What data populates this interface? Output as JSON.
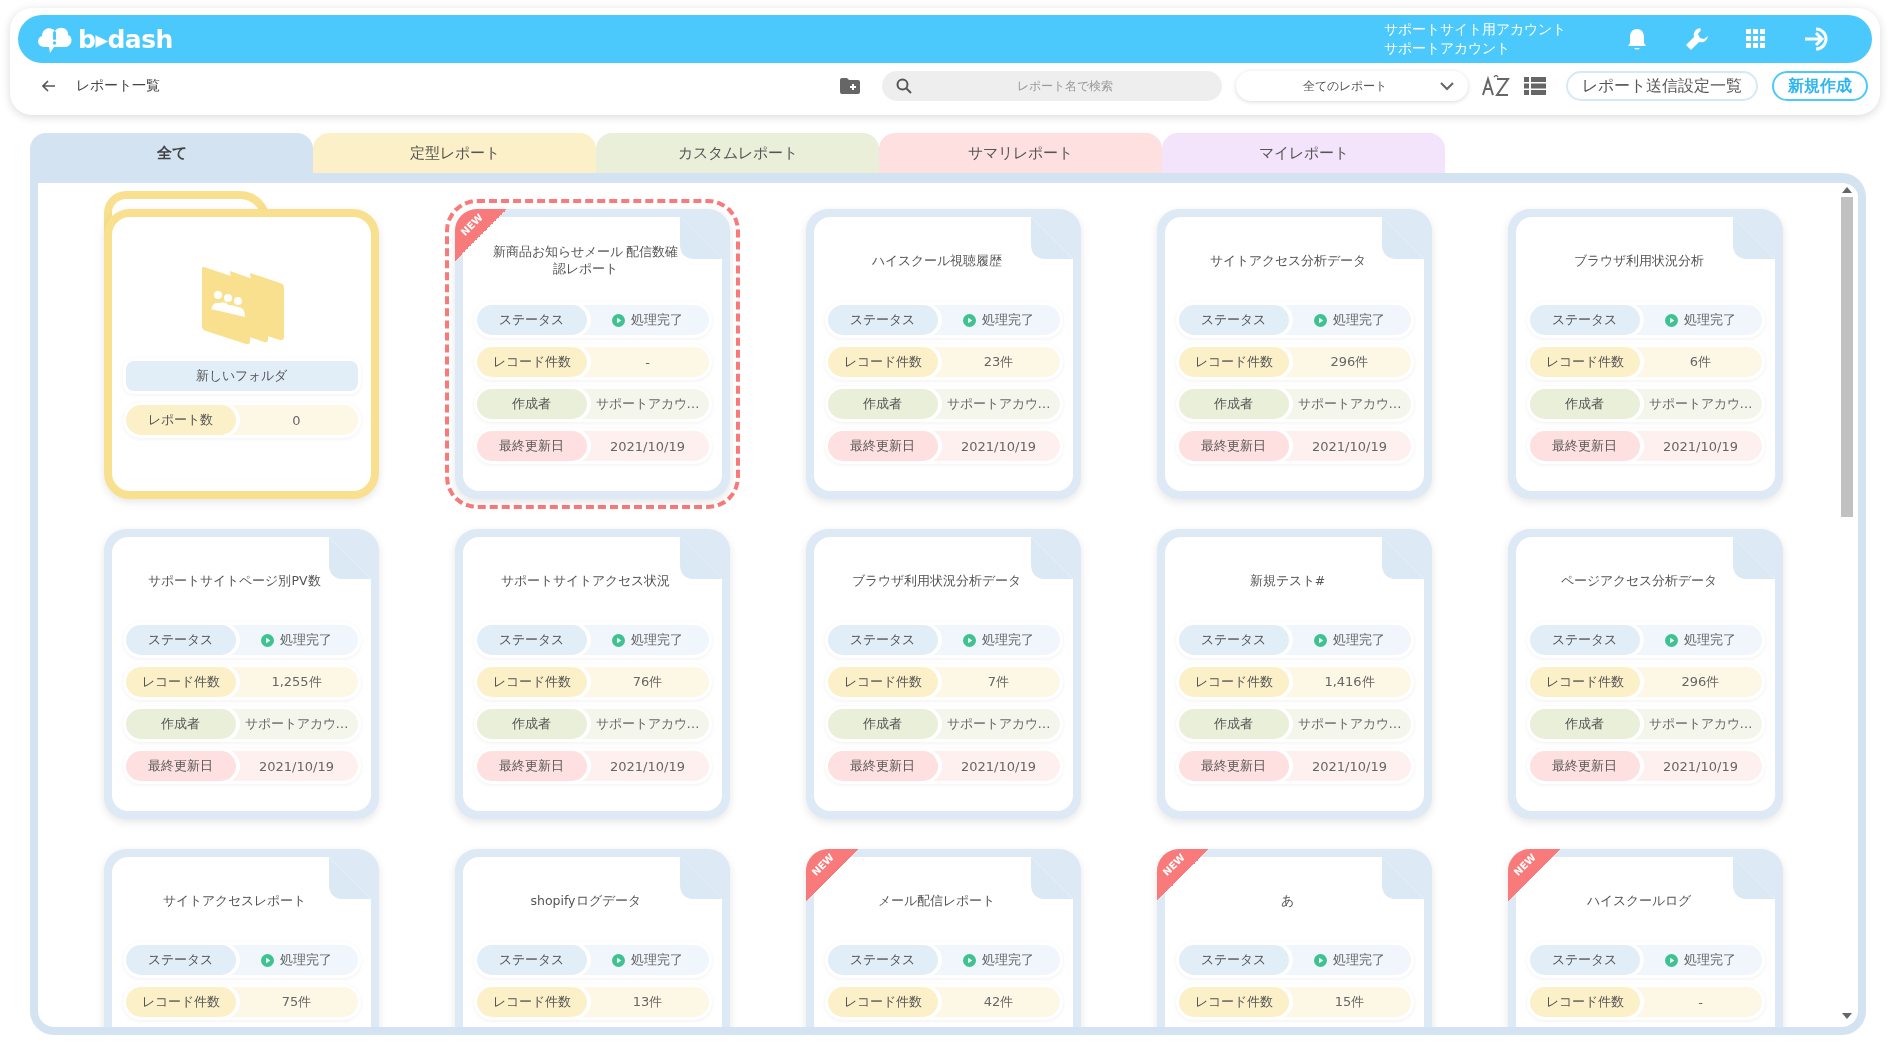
{
  "header": {
    "logo": "b▸dash",
    "account": [
      "サポートサイト用アカウント",
      "サポートアカウント"
    ]
  },
  "toolbar": {
    "title": "レポート一覧",
    "search": {
      "placeholder": "レポート名で検索"
    },
    "filter": "全てのレポート",
    "buttons": [
      "レポート送信設定一覧",
      "新規作成"
    ]
  },
  "tabs": [
    {
      "label": "全て",
      "selected": true,
      "color": "#d3e3f1"
    },
    {
      "label": "定型レポート",
      "selected": false,
      "color": "#fcf0c8"
    },
    {
      "label": "カスタムレポート",
      "selected": false,
      "color": "#e9efd9"
    },
    {
      "label": "サマリレポート",
      "selected": false,
      "color": "#fde0df"
    },
    {
      "label": "マイレポート",
      "selected": false,
      "color": "#f3e4fb"
    }
  ],
  "folders": [
    {
      "name": "新しいフォルダ",
      "label": "レポート数",
      "count": "0"
    }
  ],
  "reports": [
    {
      "title": "新商品お知らせメール 配信数確認レポート",
      "badge": "NEW",
      "selected": true,
      "rows": [
        {
          "kind": "status",
          "label": "ステータス",
          "value": "処理完了"
        },
        {
          "kind": "count",
          "label": "レコード件数",
          "value": "-"
        },
        {
          "kind": "creator",
          "label": "作成者",
          "value": "サポートアカウ…"
        },
        {
          "kind": "date",
          "label": "最終更新日",
          "value": "2021/10/19"
        }
      ]
    },
    {
      "title": "ハイスクール視聴履歴",
      "selected": false,
      "rows": [
        {
          "kind": "status",
          "label": "ステータス",
          "value": "処理完了"
        },
        {
          "kind": "count",
          "label": "レコード件数",
          "value": "23件"
        },
        {
          "kind": "creator",
          "label": "作成者",
          "value": "サポートアカウ…"
        },
        {
          "kind": "date",
          "label": "最終更新日",
          "value": "2021/10/19"
        }
      ]
    },
    {
      "title": "サイトアクセス分析データ",
      "selected": false,
      "rows": [
        {
          "kind": "status",
          "label": "ステータス",
          "value": "処理完了"
        },
        {
          "kind": "count",
          "label": "レコード件数",
          "value": "296件"
        },
        {
          "kind": "creator",
          "label": "作成者",
          "value": "サポートアカウ…"
        },
        {
          "kind": "date",
          "label": "最終更新日",
          "value": "2021/10/19"
        }
      ]
    },
    {
      "title": "ブラウザ利用状況分析",
      "selected": false,
      "rows": [
        {
          "kind": "status",
          "label": "ステータス",
          "value": "処理完了"
        },
        {
          "kind": "count",
          "label": "レコード件数",
          "value": "6件"
        },
        {
          "kind": "creator",
          "label": "作成者",
          "value": "サポートアカウ…"
        },
        {
          "kind": "date",
          "label": "最終更新日",
          "value": "2021/10/19"
        }
      ]
    },
    {
      "title": "サポートサイトページ別PV数",
      "selected": false,
      "rows": [
        {
          "kind": "status",
          "label": "ステータス",
          "value": "処理完了"
        },
        {
          "kind": "count",
          "label": "レコード件数",
          "value": "1,255件"
        },
        {
          "kind": "creator",
          "label": "作成者",
          "value": "サポートアカウ…"
        },
        {
          "kind": "date",
          "label": "最終更新日",
          "value": "2021/10/19"
        }
      ]
    },
    {
      "title": "サポートサイトアクセス状況",
      "selected": false,
      "rows": [
        {
          "kind": "status",
          "label": "ステータス",
          "value": "処理完了"
        },
        {
          "kind": "count",
          "label": "レコード件数",
          "value": "76件"
        },
        {
          "kind": "creator",
          "label": "作成者",
          "value": "サポートアカウ…"
        },
        {
          "kind": "date",
          "label": "最終更新日",
          "value": "2021/10/19"
        }
      ]
    },
    {
      "title": "ブラウザ利用状況分析データ",
      "selected": false,
      "rows": [
        {
          "kind": "status",
          "label": "ステータス",
          "value": "処理完了"
        },
        {
          "kind": "count",
          "label": "レコード件数",
          "value": "7件"
        },
        {
          "kind": "creator",
          "label": "作成者",
          "value": "サポートアカウ…"
        },
        {
          "kind": "date",
          "label": "最終更新日",
          "value": "2021/10/19"
        }
      ]
    },
    {
      "title": "新規テスト#",
      "selected": false,
      "rows": [
        {
          "kind": "status",
          "label": "ステータス",
          "value": "処理完了"
        },
        {
          "kind": "count",
          "label": "レコード件数",
          "value": "1,416件"
        },
        {
          "kind": "creator",
          "label": "作成者",
          "value": "サポートアカウ…"
        },
        {
          "kind": "date",
          "label": "最終更新日",
          "value": "2021/10/19"
        }
      ]
    },
    {
      "title": "ページアクセス分析データ",
      "selected": false,
      "rows": [
        {
          "kind": "status",
          "label": "ステータス",
          "value": "処理完了"
        },
        {
          "kind": "count",
          "label": "レコード件数",
          "value": "296件"
        },
        {
          "kind": "creator",
          "label": "作成者",
          "value": "サポートアカウ…"
        },
        {
          "kind": "date",
          "label": "最終更新日",
          "value": "2021/10/19"
        }
      ]
    },
    {
      "title": "サイトアクセスレポート",
      "selected": false,
      "rows": [
        {
          "kind": "status",
          "label": "ステータス",
          "value": "処理完了"
        },
        {
          "kind": "count",
          "label": "レコード件数",
          "value": "75件"
        }
      ]
    },
    {
      "title": "shopifyログデータ",
      "selected": false,
      "rows": [
        {
          "kind": "status",
          "label": "ステータス",
          "value": "処理完了"
        },
        {
          "kind": "count",
          "label": "レコード件数",
          "value": "13件"
        }
      ]
    },
    {
      "title": "メール配信レポート",
      "badge": "NEW",
      "selected": false,
      "rows": [
        {
          "kind": "status",
          "label": "ステータス",
          "value": "処理完了"
        },
        {
          "kind": "count",
          "label": "レコード件数",
          "value": "42件"
        }
      ]
    },
    {
      "title": "あ",
      "badge": "NEW",
      "selected": false,
      "rows": [
        {
          "kind": "status",
          "label": "ステータス",
          "value": "処理完了"
        },
        {
          "kind": "count",
          "label": "レコード件数",
          "value": "15件"
        }
      ]
    },
    {
      "title": "ハイスクールログ",
      "badge": "NEW",
      "selected": false,
      "rows": [
        {
          "kind": "status",
          "label": "ステータス",
          "value": "処理完了"
        },
        {
          "kind": "count",
          "label": "レコード件数",
          "value": "-"
        }
      ]
    }
  ]
}
